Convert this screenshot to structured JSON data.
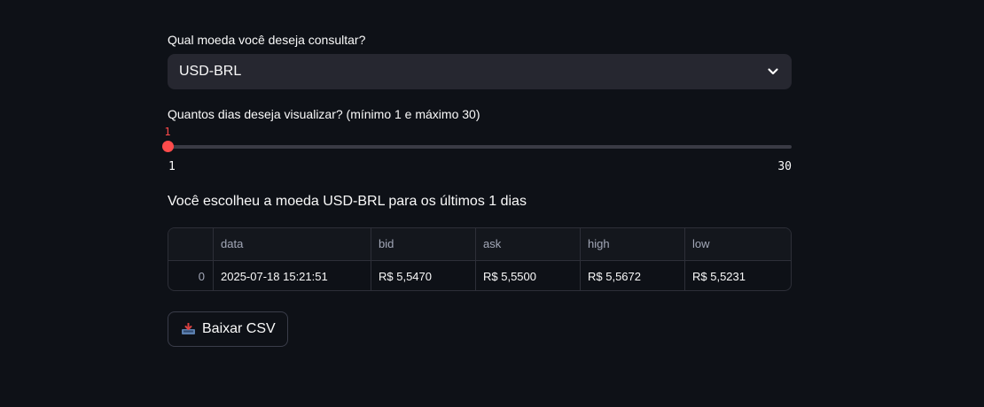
{
  "currency_select": {
    "label": "Qual moeda você deseja consultar?",
    "value": "USD-BRL",
    "icon": "chevron-down-icon"
  },
  "days_slider": {
    "label": "Quantos dias deseja visualizar? (mínimo 1 e máximo 30)",
    "value": "1",
    "min": "1",
    "max": "30",
    "fraction": 0.0,
    "accent_color": "#ff4b4b"
  },
  "result": {
    "text": "Você escolheu a moeda USD-BRL para os últimos 1 dias"
  },
  "table": {
    "columns": [
      "",
      "data",
      "bid",
      "ask",
      "high",
      "low"
    ],
    "rows": [
      [
        "0",
        "2025-07-18 15:21:51",
        "R$ 5,5470",
        "R$ 5,5500",
        "R$ 5,5672",
        "R$ 5,5231"
      ]
    ]
  },
  "download": {
    "label": "Baixar CSV",
    "icon": "inbox-tray-icon"
  },
  "colors": {
    "background": "#0e1117",
    "widget_bg": "#262730",
    "accent": "#ff4b4b"
  }
}
